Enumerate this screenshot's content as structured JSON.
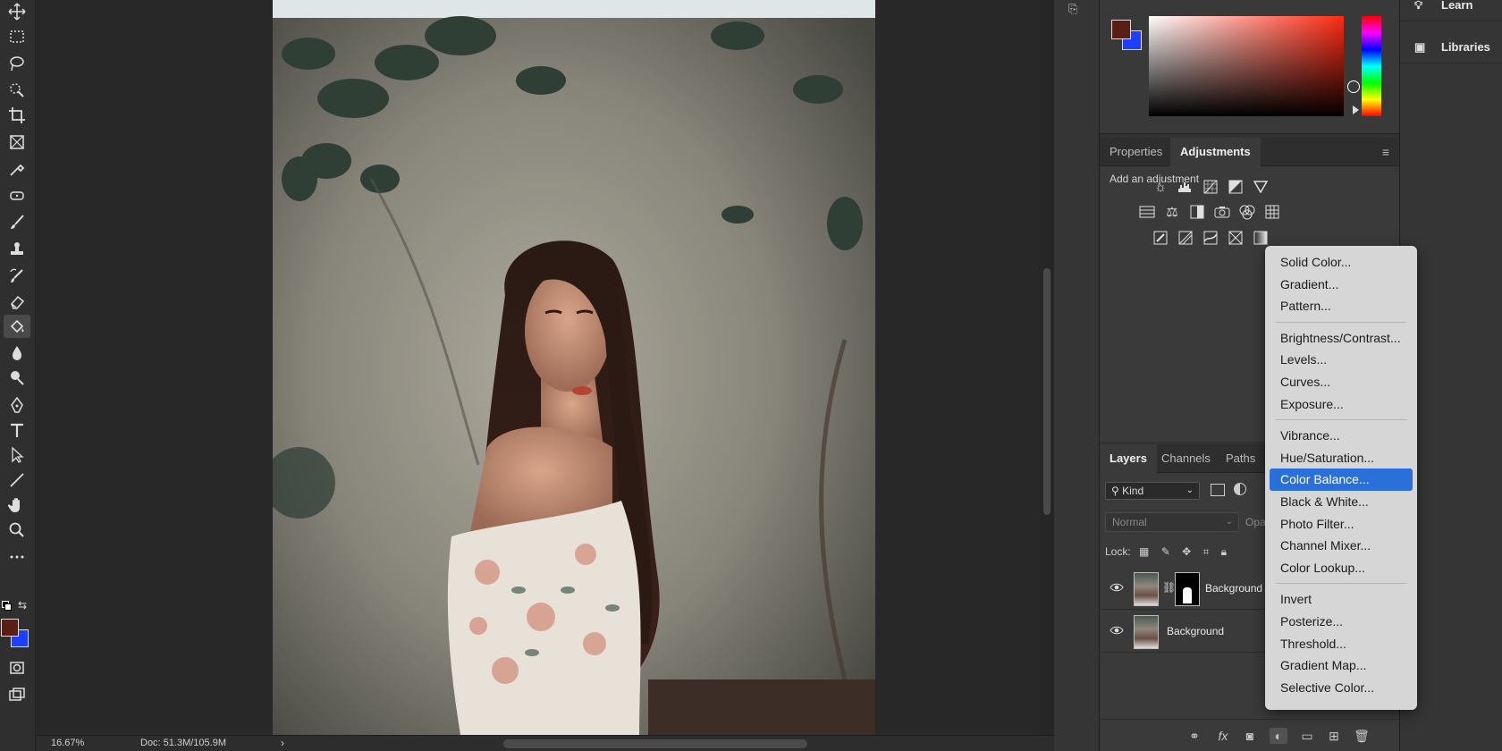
{
  "toolbar": {
    "tools": [
      "move-icon",
      "marquee-icon",
      "lasso-icon",
      "quick-select-icon",
      "crop-icon",
      "frame-icon",
      "eyedropper-icon",
      "healing-icon",
      "brush-icon",
      "stamp-icon",
      "history-brush-icon",
      "eraser-icon",
      "paint-bucket-icon",
      "blur-icon",
      "dodge-icon",
      "pen-icon",
      "type-icon",
      "path-select-icon",
      "line-icon",
      "hand-icon",
      "zoom-icon",
      "more-tools-icon"
    ],
    "active_tool": "paint-bucket-icon",
    "foreground_color": "#5a1e14",
    "background_color": "#1d3fff"
  },
  "status": {
    "zoom": "16.67%",
    "doc": "Doc: 51.3M/105.9M",
    "arrow": "›"
  },
  "color_panel": {
    "foreground": "#5a1e14",
    "background": "#1d3fff",
    "hue": "#ff2a12"
  },
  "adjustments_panel": {
    "tabs": [
      "Properties",
      "Adjustments"
    ],
    "active_tab": "Adjustments",
    "hint": "Add an adjustment",
    "icons": [
      "brightness-contrast-icon",
      "levels-icon",
      "curves-icon",
      "exposure-icon",
      "vibrance-icon",
      "hue-saturation-icon",
      "color-balance-icon",
      "black-white-icon",
      "photo-filter-icon",
      "channel-mixer-icon",
      "color-lookup-icon",
      "invert-icon",
      "posterize-icon",
      "threshold-icon",
      "selective-color-icon",
      "gradient-map-icon"
    ]
  },
  "layers_panel": {
    "tabs": [
      "Layers",
      "Channels",
      "Paths"
    ],
    "active_tab": "Layers",
    "kind_filter": "Kind",
    "blend_mode": "Normal",
    "opacity_label": "Opa",
    "lock_label": "Lock:",
    "layers": [
      {
        "name": "Background",
        "has_mask": true
      },
      {
        "name": "Background",
        "has_mask": false
      }
    ]
  },
  "mini_panel": {
    "items": [
      "Learn",
      "Libraries"
    ]
  },
  "dropdown": {
    "groups": [
      [
        "Solid Color...",
        "Gradient...",
        "Pattern..."
      ],
      [
        "Brightness/Contrast...",
        "Levels...",
        "Curves...",
        "Exposure..."
      ],
      [
        "Vibrance...",
        "Hue/Saturation...",
        "Color Balance...",
        "Black & White...",
        "Photo Filter...",
        "Channel Mixer...",
        "Color Lookup..."
      ],
      [
        "Invert",
        "Posterize...",
        "Threshold...",
        "Gradient Map...",
        "Selective Color..."
      ]
    ],
    "highlighted": "Color Balance...",
    "highlight_color": "#2a70d8"
  }
}
